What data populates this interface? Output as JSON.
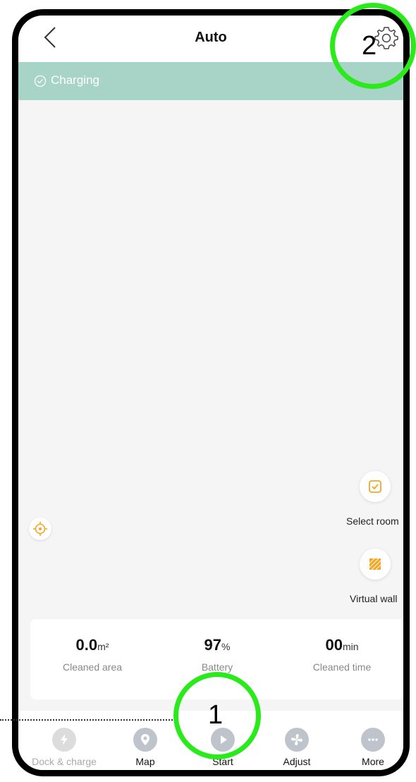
{
  "header": {
    "title": "Auto",
    "back_icon": "chevron-left-icon",
    "settings_icon": "gear-icon"
  },
  "status": {
    "text": "Charging",
    "icon": "check-circle-icon",
    "color": "#a8d4c8"
  },
  "map_tools": {
    "select_room_label": "Select room",
    "virtual_wall_label": "Virtual wall",
    "accent": "#f5a623"
  },
  "stats": [
    {
      "value": "0.0",
      "unit": "m²",
      "label": "Cleaned area"
    },
    {
      "value": "97",
      "unit": "%",
      "label": "Battery"
    },
    {
      "value": "00",
      "unit": "min",
      "label": "Cleaned time"
    }
  ],
  "nav": [
    {
      "label": "Dock & charge",
      "icon": "dock-charge-icon",
      "disabled": true
    },
    {
      "label": "Map",
      "icon": "map-pin-icon",
      "disabled": false
    },
    {
      "label": "Start",
      "icon": "play-icon",
      "disabled": false
    },
    {
      "label": "Adjust",
      "icon": "fan-icon",
      "disabled": false
    },
    {
      "label": "More",
      "icon": "more-icon",
      "disabled": false
    }
  ],
  "annotations": [
    {
      "number": "1",
      "color": "#2bea1c"
    },
    {
      "number": "2",
      "color": "#2bea1c"
    }
  ]
}
